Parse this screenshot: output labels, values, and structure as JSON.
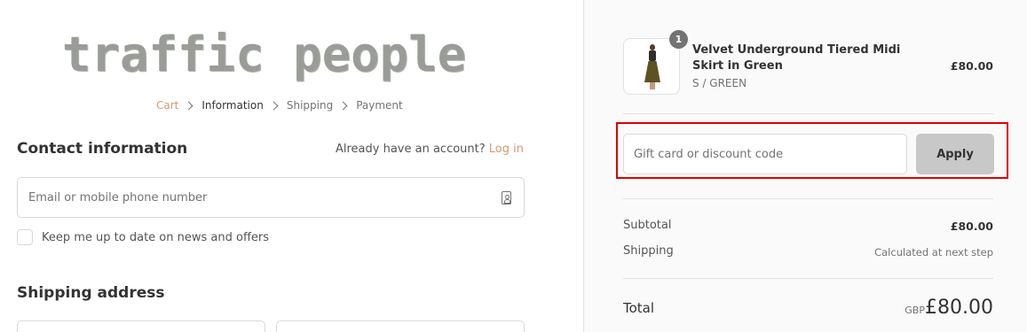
{
  "brand": {
    "logo_text": "traffic people"
  },
  "breadcrumb": {
    "items": [
      "Cart",
      "Information",
      "Shipping",
      "Payment"
    ]
  },
  "contact": {
    "title": "Contact information",
    "account_prompt": "Already have an account?",
    "login_label": "Log in",
    "email_placeholder": "Email or mobile phone number",
    "newsletter_label": "Keep me up to date on news and offers"
  },
  "shipping": {
    "title": "Shipping address"
  },
  "order": {
    "product": {
      "name": "Velvet Underground Tiered Midi Skirt in Green",
      "variant": "S / GREEN",
      "price": "£80.00",
      "quantity": "1"
    },
    "discount": {
      "placeholder": "Gift card or discount code",
      "apply_label": "Apply"
    },
    "subtotal_label": "Subtotal",
    "subtotal_value": "£80.00",
    "shipping_label": "Shipping",
    "shipping_value": "Calculated at next step",
    "total_label": "Total",
    "total_currency": "GBP",
    "total_value": "£80.00"
  },
  "colors": {
    "accent": "#d39a72",
    "highlight": "#e00000",
    "apply_button_bg": "#c8c8c8"
  }
}
